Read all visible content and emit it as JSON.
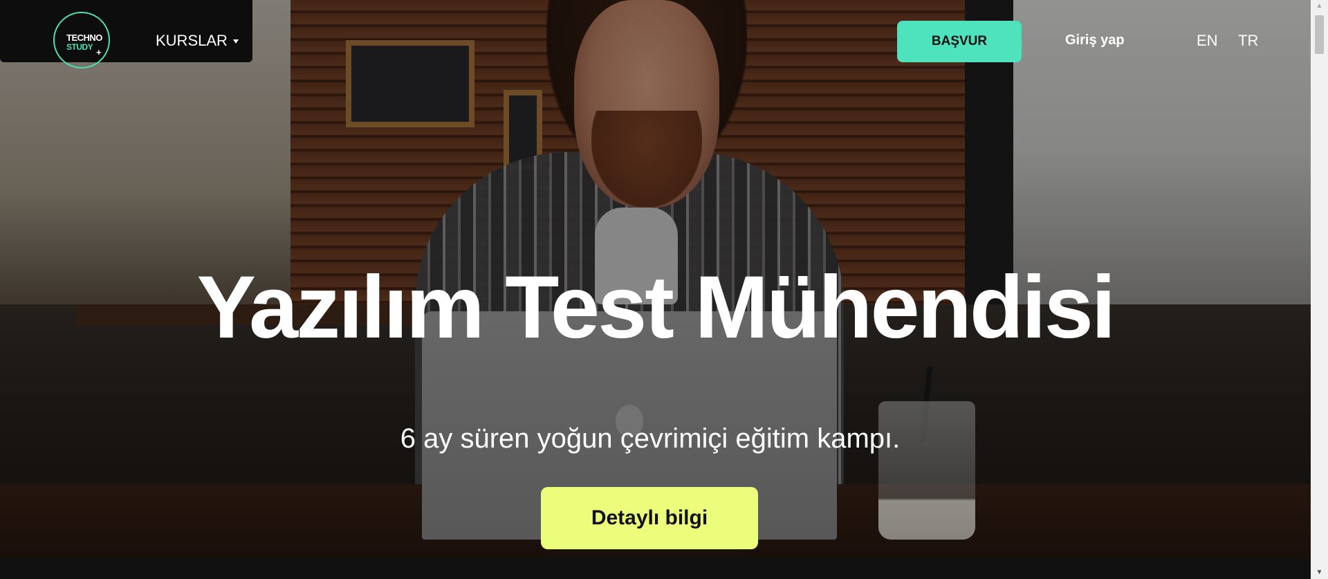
{
  "header": {
    "logo": {
      "line1": "TECHNO",
      "line2": "STUDY",
      "plus": "+",
      "accent_color": "#4ce0b3"
    },
    "courses_menu_label": "KURSLAR",
    "apply_button_label": "BAŞVUR",
    "apply_button_color": "#4fe3bd",
    "login_label": "Giriş yap",
    "languages": [
      "EN",
      "TR"
    ]
  },
  "hero": {
    "title": "Yazılım Test Mühendisi",
    "subtitle": "6 ay süren yoğun çevrimiçi eğitim kampı.",
    "cta_label": "Detaylı bilgi",
    "cta_color": "#ebfd7a"
  },
  "icons": {
    "dropdown": "chevron-down-icon",
    "scroll_up": "arrow-up-icon",
    "scroll_down": "arrow-down-icon"
  }
}
